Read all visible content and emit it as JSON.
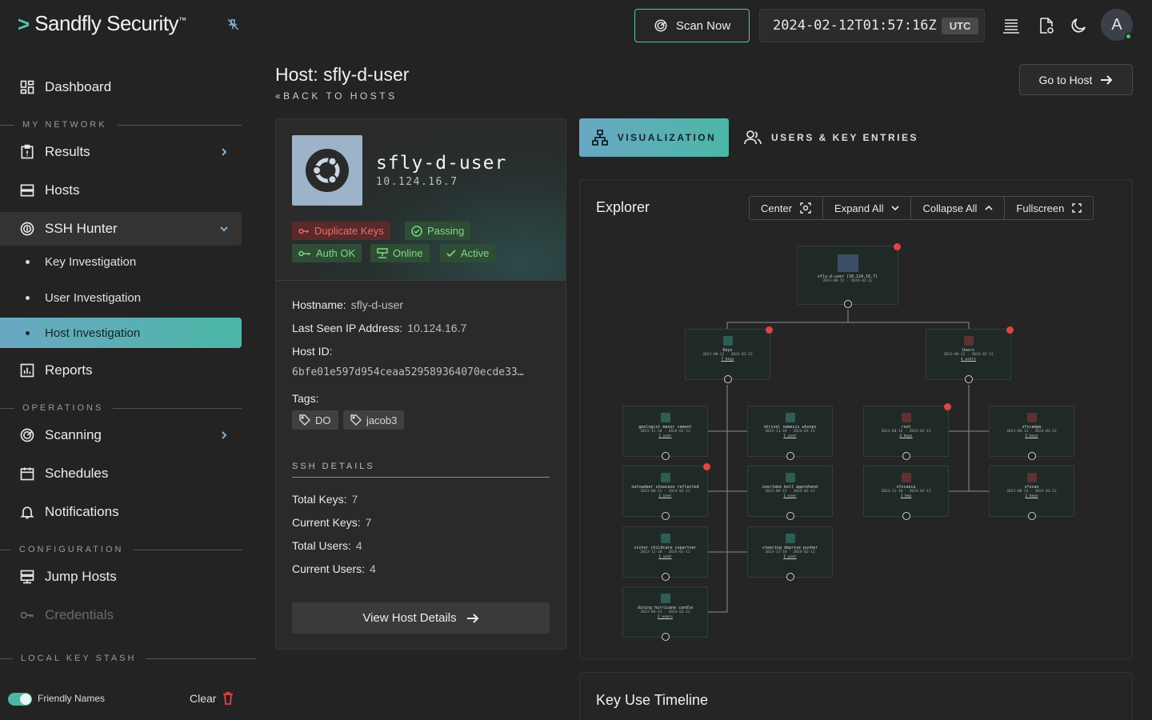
{
  "app": {
    "brand": "Sandfly Security",
    "trademark": "™"
  },
  "header": {
    "scan_label": "Scan Now",
    "time": "2024-02-12T01:57:16Z",
    "tz": "UTC",
    "avatar_initial": "A"
  },
  "sidebar": {
    "dashboard": "Dashboard",
    "section_network": "MY NETWORK",
    "results": "Results",
    "hosts": "Hosts",
    "ssh_hunter": "SSH Hunter",
    "key_investigation": "Key Investigation",
    "user_investigation": "User Investigation",
    "host_investigation": "Host Investigation",
    "reports": "Reports",
    "section_operations": "OPERATIONS",
    "scanning": "Scanning",
    "schedules": "Schedules",
    "notifications": "Notifications",
    "section_configuration": "CONFIGURATION",
    "jump_hosts": "Jump Hosts",
    "credentials": "Credentials",
    "section_stash": "LOCAL KEY STASH",
    "friendly_names": "Friendly Names",
    "clear": "Clear"
  },
  "page": {
    "title": "Host: sfly-d-user",
    "back": "«BACK TO HOSTS",
    "goto": "Go to Host"
  },
  "host": {
    "name": "sfly-d-user",
    "ip": "10.124.16.7",
    "badges": {
      "duplicate": "Duplicate Keys",
      "passing": "Passing",
      "auth": "Auth OK",
      "online": "Online",
      "active": "Active"
    },
    "hostname_label": "Hostname:",
    "hostname": "sfly-d-user",
    "lastip_label": "Last Seen IP Address:",
    "lastip": "10.124.16.7",
    "hostid_label": "Host ID:",
    "hostid": "6bfe01e597d954ceaa529589364070ecde33…",
    "tags_label": "Tags:",
    "tags": [
      "DO",
      "jacob3"
    ],
    "ssh_header": "SSH DETAILS",
    "total_keys_label": "Total Keys:",
    "total_keys": "7",
    "current_keys_label": "Current Keys:",
    "current_keys": "7",
    "total_users_label": "Total Users:",
    "total_users": "4",
    "current_users_label": "Current Users:",
    "current_users": "4",
    "view_details": "View Host Details"
  },
  "tabs": {
    "viz": "VISUALIZATION",
    "users": "USERS & KEY ENTRIES"
  },
  "explorer": {
    "title": "Explorer",
    "center": "Center",
    "expand": "Expand All",
    "collapse": "Collapse All",
    "fullscreen": "Fullscreen",
    "root": {
      "title": "sfly-d-user (10.124.16.7)",
      "dates": "2023-08-12 - 2024-02-12"
    },
    "keys": {
      "title": "Keys",
      "dates": "2023-08-12 - 2024-02-12",
      "count": "7 keys"
    },
    "users": {
      "title": "Users",
      "dates": "2023-08-12 - 2024-02-12",
      "count": "4 users"
    },
    "key_nodes": [
      {
        "title": "geologist manor cement",
        "dates": "2023-11-10 - 2024-02-12",
        "count": "1 user"
      },
      {
        "title": "shrivel nemesis whoops",
        "dates": "2023-11-10 - 2024-02-12",
        "count": "1 user"
      },
      {
        "title": "outnumber showcase reflected",
        "dates": "2023-08-12 - 2024-02-12",
        "count": "1 user"
      },
      {
        "title": "overtake bolt apprehend",
        "dates": "2023-08-12 - 2024-02-12",
        "count": "1 user"
      },
      {
        "title": "sister childcare copartner",
        "dates": "2023-11-10 - 2024-02-12",
        "count": "1 user"
      },
      {
        "title": "steering deprive pusher",
        "dates": "2023-11-10 - 2024-02-12",
        "count": "1 user"
      },
      {
        "title": "dining hurricane candle",
        "dates": "2023-08-12 - 2024-02-12",
        "count": "2 users"
      }
    ],
    "user_nodes": [
      {
        "title": "root",
        "dates": "2023-08-12 - 2024-02-12",
        "count": "4 keys"
      },
      {
        "title": "sfscampe",
        "dates": "2023-08-12 - 2024-02-12",
        "count": "2 keys"
      },
      {
        "title": "sfscanca",
        "dates": "2023-11-10 - 2024-02-12",
        "count": "1 key"
      },
      {
        "title": "sfscan",
        "dates": "2023-08-12 - 2024-02-12",
        "count": "2 keys"
      }
    ]
  },
  "timeline": {
    "title": "Key Use Timeline"
  }
}
